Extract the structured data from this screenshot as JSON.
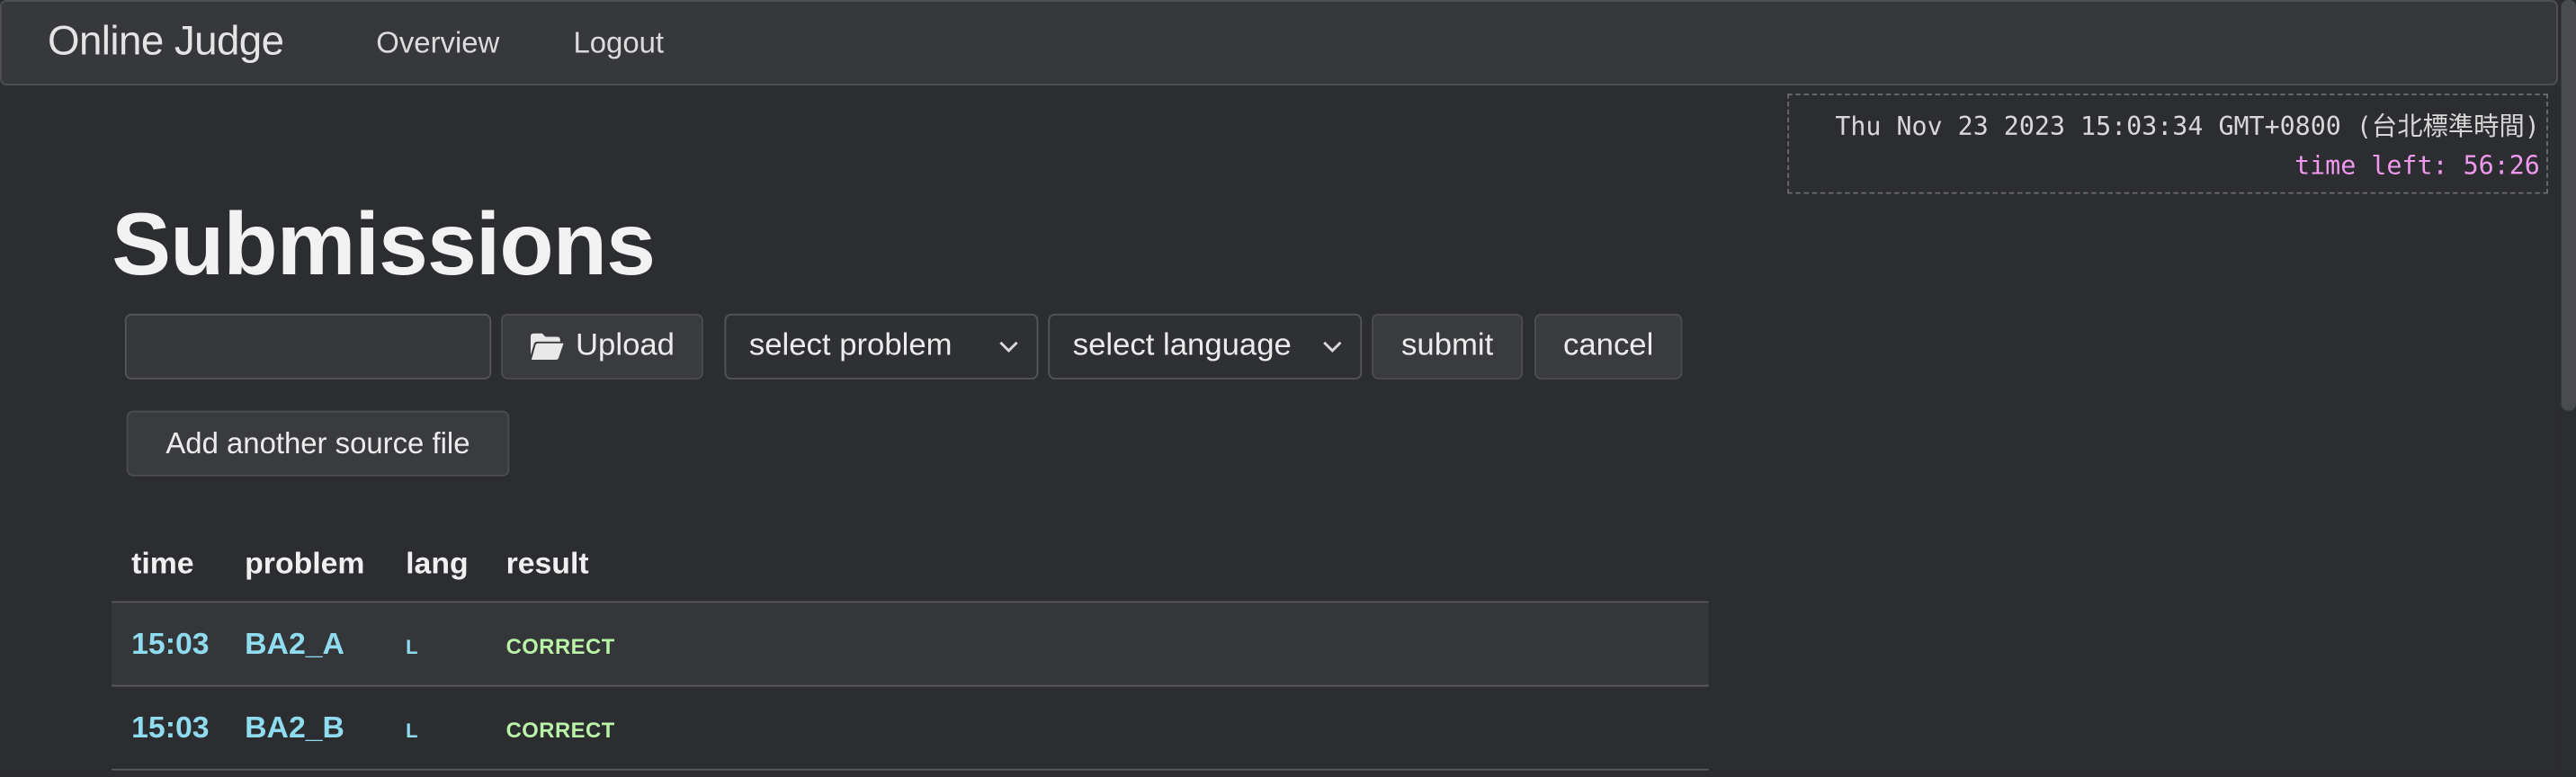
{
  "navbar": {
    "brand": "Online Judge",
    "links": [
      "Overview",
      "Logout"
    ]
  },
  "clock": {
    "datetime": "Thu Nov 23 2023 15:03:34 GMT+0800 (台北標準時間)",
    "time_left": "time left: 56:26"
  },
  "page": {
    "title": "Submissions"
  },
  "submit_form": {
    "file_value": "",
    "upload_label": "Upload",
    "problem_select": "select problem",
    "language_select": "select language",
    "submit_label": "submit",
    "cancel_label": "cancel",
    "add_source_label": "Add another source file"
  },
  "table": {
    "headers": [
      "time",
      "problem",
      "lang",
      "result"
    ],
    "rows": [
      {
        "time": "15:03",
        "problem": "BA2_A",
        "lang": "L",
        "result": "CORRECT"
      },
      {
        "time": "15:03",
        "problem": "BA2_B",
        "lang": "L",
        "result": "CORRECT"
      }
    ]
  },
  "icons": {
    "upload": "folder-open-icon",
    "select": "chevron-down-icon"
  },
  "colors": {
    "background": "#2c2d30",
    "link_cyan": "#8fdcf0",
    "correct_green": "#b9f3a6",
    "time_left_pink": "#ee99ee"
  }
}
